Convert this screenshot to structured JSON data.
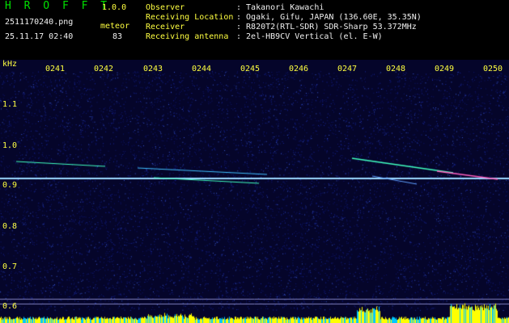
{
  "app": {
    "name": "H R O F F T",
    "version": "1.0.0"
  },
  "file": {
    "name": "2511170240.png",
    "timestamp": "25.11.17 02:40"
  },
  "meteor": {
    "label": "meteor",
    "count": "83"
  },
  "info": [
    {
      "label": "Observer",
      "value": ": Takanori Kawachi"
    },
    {
      "label": "Receiving Location",
      "value": ": Ogaki, Gifu, JAPAN (136.60E, 35.35N)"
    },
    {
      "label": "Receiver",
      "value": ": R820T2(RTL-SDR) SDR-Sharp 53.372MHz"
    },
    {
      "label": "Receiving antenna",
      "value": ": 2el-HB9CV Vertical (el. E-W)"
    }
  ],
  "spectrogram": {
    "y_unit": "kHz",
    "time_ticks": [
      "0241",
      "0242",
      "0243",
      "0244",
      "0245",
      "0246",
      "0247",
      "0248",
      "0249",
      "0250"
    ],
    "freq_ticks": [
      "1.1",
      "1.0",
      "0.9",
      "0.8",
      "0.7",
      "0.6"
    ],
    "colors": {
      "background": "#05052a",
      "noise": "#1a2aa0",
      "carrier": "#9bd8ff",
      "echo": "#40ffc0",
      "level": "#ffff00",
      "level_edge": "#00c8ff"
    }
  }
}
